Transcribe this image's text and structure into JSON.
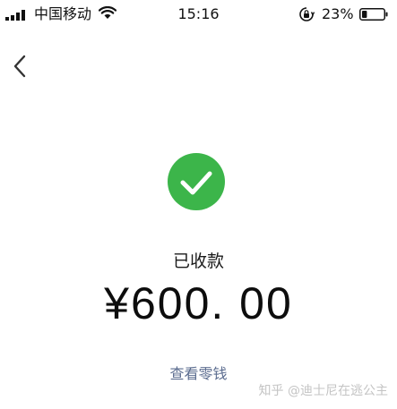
{
  "status_bar": {
    "carrier": "中国移动",
    "time": "15:16",
    "battery_percent": "23%",
    "battery_level": 0.23,
    "icons": [
      "signal-icon",
      "wifi-icon",
      "rotation-lock-icon",
      "battery-icon"
    ]
  },
  "nav": {
    "back_icon": "chevron-left-icon"
  },
  "receipt": {
    "status_icon": "check-circle-icon",
    "status_color": "#3cb54a",
    "status_label": "已收款",
    "amount": "¥600. 00",
    "view_change_link": "查看零钱",
    "link_color": "#5b6c8f"
  },
  "watermark": {
    "text": "知乎 @迪士尼在逃公主"
  }
}
